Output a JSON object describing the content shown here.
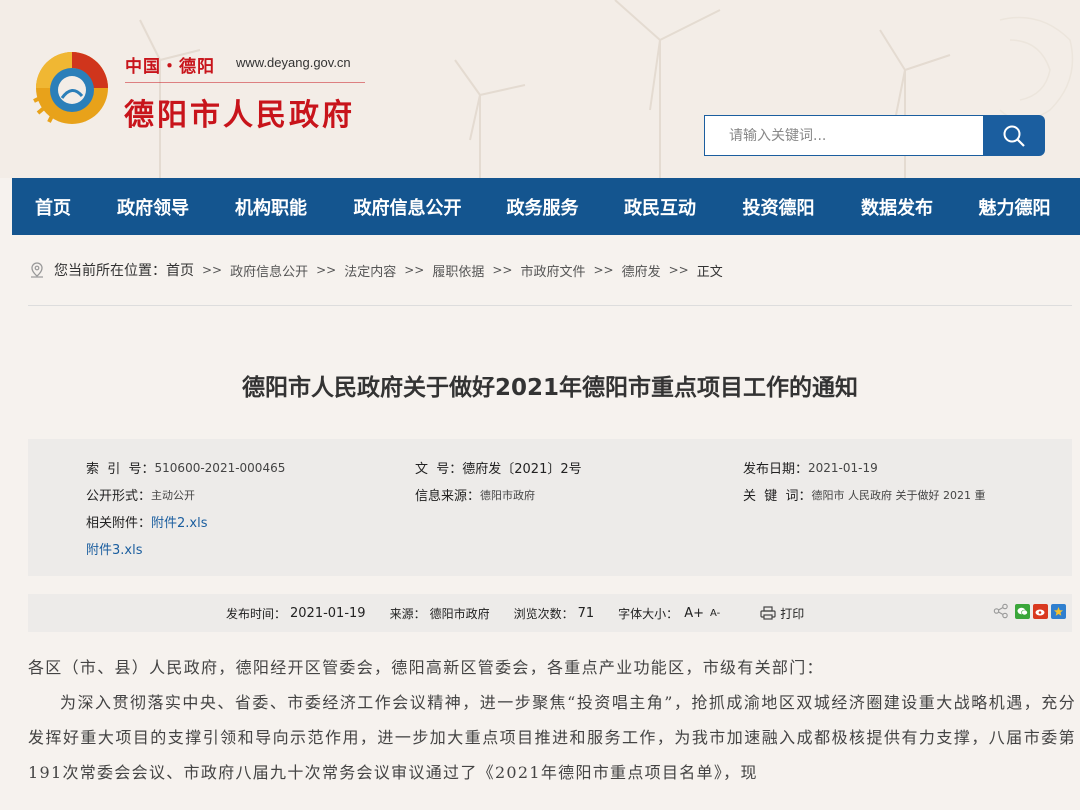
{
  "header": {
    "site_small": "中国・德阳",
    "site_url": "www.deyang.gov.cn",
    "site_name": "德阳市人民政府",
    "search_placeholder": "请输入关键词..."
  },
  "nav": [
    "首页",
    "政府领导",
    "机构职能",
    "政府信息公开",
    "政务服务",
    "政民互动",
    "投资德阳",
    "数据发布",
    "魅力德阳"
  ],
  "breadcrumb": {
    "prefix": "您当前所在位置：",
    "separator": ">>",
    "items": [
      "首页",
      "政府信息公开",
      "法定内容",
      "履职依据",
      "市政府文件",
      "德府发",
      "正文"
    ]
  },
  "title": "德阳市人民政府关于做好2021年德阳市重点项目工作的通知",
  "meta": {
    "index_label": "索  引  号：",
    "index_value": "510600-2021-000465",
    "docno_label": "文  号：",
    "docno_value": "德府发〔2021〕2号",
    "pubdate_label": "发布日期：",
    "pubdate_value": "2021-01-19",
    "form_label": "公开形式：",
    "form_value": "主动公开",
    "source_label": "信息来源：",
    "source_value": "德阳市政府",
    "keyword_label": "关  键  词：",
    "keyword_value": "德阳市 人民政府 关于做好 2021 重",
    "attach_label": "相关附件：",
    "attachments": [
      "附件2.xls",
      "附件3.xls"
    ]
  },
  "info": {
    "time_label": "发布时间：",
    "time_value": "2021-01-19",
    "source_label": "来源：",
    "source_value": "德阳市政府",
    "views_label": "浏览次数：",
    "views_value": "71",
    "fontsize_label": "字体大小：",
    "font_plus": "A+",
    "font_minus": "A-",
    "print_label": "打印"
  },
  "body": {
    "greeting": "各区（市、县）人民政府，德阳经开区管委会，德阳高新区管委会，各重点产业功能区，市级有关部门：",
    "paragraph": "为深入贯彻落实中央、省委、市委经济工作会议精神，进一步聚焦“投资唱主角”，抢抓成渝地区双城经济圈建设重大战略机遇，充分发挥好重大项目的支撑引领和导向示范作用，进一步加大重点项目推进和服务工作，为我市加速融入成都极核提供有力支撑，八届市委第191次常委会会议、市政府八届九十次常务会议审议通过了《2021年德阳市重点项目名单》，现"
  },
  "colors": {
    "brand_red": "#c8141b",
    "nav_blue": "#14558f",
    "link_blue": "#1b5e9f"
  }
}
